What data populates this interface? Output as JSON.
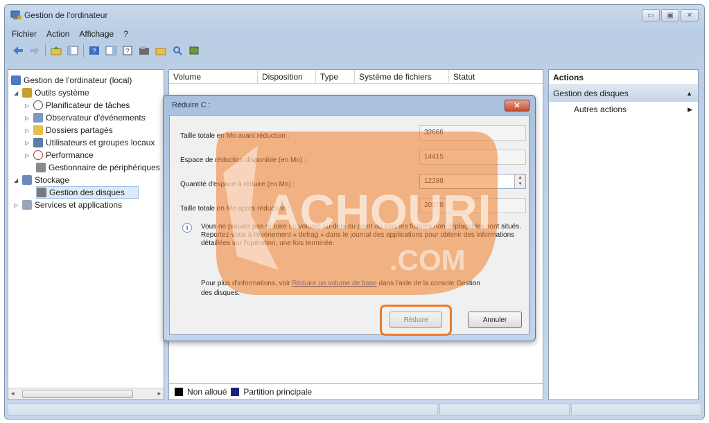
{
  "window": {
    "title": "Gestion de l'ordinateur",
    "buttons": [
      "▭",
      "▣",
      "✕"
    ]
  },
  "menu": [
    "Fichier",
    "Action",
    "Affichage",
    "?"
  ],
  "tree": [
    {
      "label": "Gestion de l'ordinateur (local)",
      "level": 0,
      "expander": ""
    },
    {
      "label": "Outils système",
      "level": 1,
      "expander": "◢"
    },
    {
      "label": "Planificateur de tâches",
      "level": 2,
      "expander": "▷"
    },
    {
      "label": "Observateur d'événements",
      "level": 2,
      "expander": "▷"
    },
    {
      "label": "Dossiers partagés",
      "level": 2,
      "expander": "▷"
    },
    {
      "label": "Utilisateurs et groupes locaux",
      "level": 2,
      "expander": "▷"
    },
    {
      "label": "Performance",
      "level": 2,
      "expander": "▷"
    },
    {
      "label": "Gestionnaire de périphériques",
      "level": 2,
      "expander": ""
    },
    {
      "label": "Stockage",
      "level": 1,
      "expander": "◢"
    },
    {
      "label": "Gestion des disques",
      "level": 2,
      "expander": ""
    },
    {
      "label": "Services et applications",
      "level": 1,
      "expander": "▷"
    }
  ],
  "columns": [
    "Volume",
    "Disposition",
    "Type",
    "Système de fichiers",
    "Statut"
  ],
  "legend": {
    "unallocated": "Non alloué",
    "primary": "Partition principale"
  },
  "actions": {
    "header": "Actions",
    "section": "Gestion des disques",
    "item": "Autres actions"
  },
  "dialog": {
    "title": "Réduire C :",
    "close": "✕",
    "rows": [
      {
        "label": "Taille totale en Mo avant réduction :",
        "value": "32666"
      },
      {
        "label": "Espace de réduction disponible (en Mo) :",
        "value": "14415"
      },
      {
        "label": "Quantité d'espace à réduire (en Mo) :",
        "value": "12288"
      },
      {
        "label": "Taille totale en Mo après réduction :",
        "value": "20378"
      }
    ],
    "info": "Vous ne pouvez pas réduire un volume au-delà du point où tous les fichiers non déplaçables sont situés. Reportez-vous à l'événement « defrag » dans le journal des applications pour obtenir des informations détaillées sur l'opération, une fois terminée.",
    "more_prefix": "Pour plus d'informations, voir ",
    "more_link": "Réduire un volume de base",
    "more_suffix": " dans l'aide de la console Gestion des disques.",
    "btn_reduce": "Réduire",
    "btn_cancel": "Annuler"
  },
  "colors": {
    "highlight": "#ec7a27",
    "unallocated": "#000000",
    "primary": "#1a237e"
  }
}
